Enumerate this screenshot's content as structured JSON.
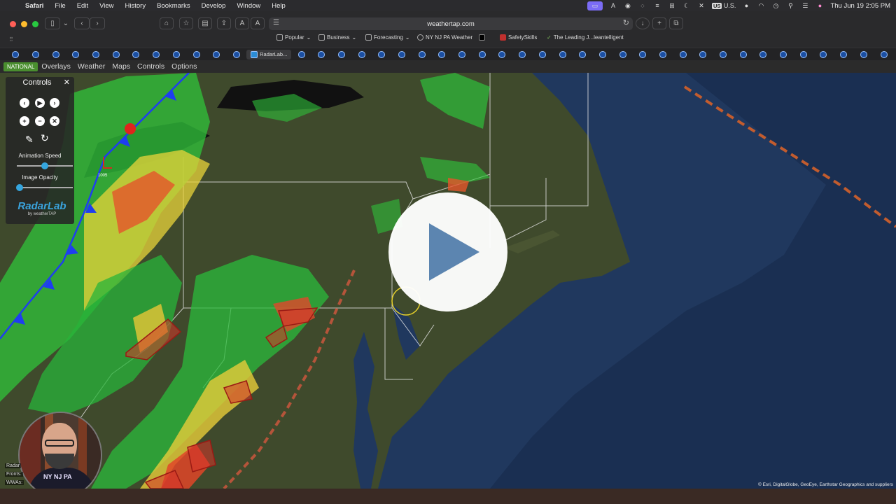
{
  "menubar": {
    "items": [
      "Safari",
      "File",
      "Edit",
      "View",
      "History",
      "Bookmarks",
      "Develop",
      "Window",
      "Help"
    ],
    "locale": "U.S.",
    "clock": "Thu Jun 19  2:05 PM"
  },
  "browser": {
    "url": "weathertap.com",
    "favorites": [
      "Popular",
      "Business",
      "Forecasting",
      "NY NJ PA Weather",
      "SafetySkills",
      "The Leading J...leantelligent"
    ],
    "active_tab": "RadarLab..."
  },
  "app": {
    "nav": [
      "NATIONAL",
      "Overlays",
      "Weather",
      "Maps",
      "Controls",
      "Options"
    ]
  },
  "controls_panel": {
    "title": "Controls",
    "animation_speed_label": "Animation Speed",
    "animation_speed": 0.5,
    "image_opacity_label": "Image Opacity",
    "image_opacity": 0.05,
    "logo": "RadarLab",
    "logo_sub": "by weatherTAP"
  },
  "map": {
    "attribution": "© Esri, DigitalGlobe, GeoEye, Earthstar Geographics and suppliers",
    "front_label": "1005"
  },
  "webcam": {
    "shirt_text": "NY NJ PA",
    "legend": [
      "Radar",
      "Fronts:",
      "WWAs:"
    ]
  }
}
